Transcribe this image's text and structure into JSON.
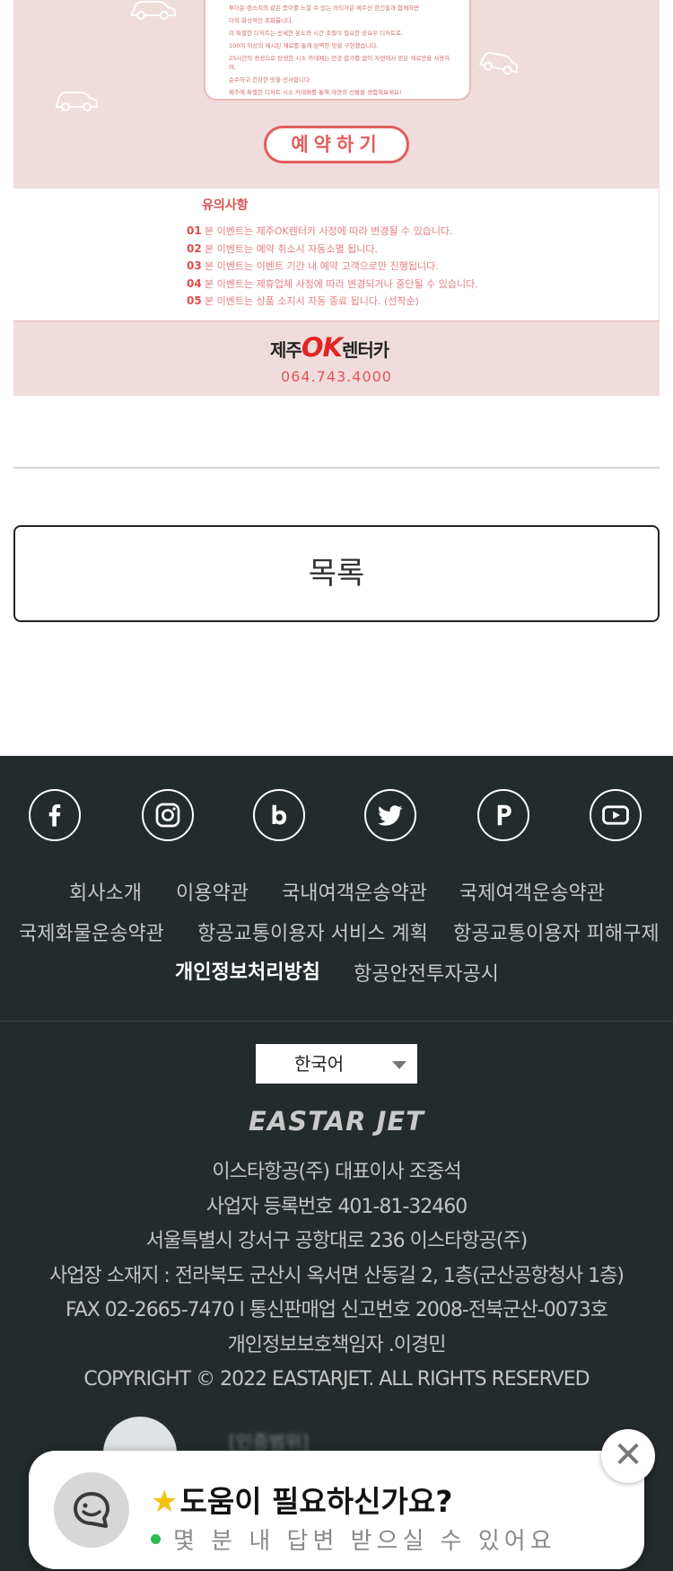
{
  "promo": {
    "card_lines": [
      "투더운 렌스치의 같은 풍이를 느낄 수 있는 카티가은 제주산 한긴들과 함께하면",
      "더욱 화상적인 조화롭니다.",
      "미 특별한 디저트는 선세한 온도와 시간 조절이 필요한 숭요우 디저트로,",
      "100여 이상의 제시된 재료를 통해 완벽한 맛을 구현했습니다.",
      "25시간의 정성으로 탄생한 시소 카데페는 먼공 합가를 없이 자연에서 얻은 재료만을 사용하여,",
      "순수하고 건강한 맛을 선사합니다.",
      "제주에 특별한 디저트 시소 카데페를 통해 자연의 선물을 경험해보세요!"
    ],
    "reserve_label": "예약하기",
    "notice_title": "유의사항",
    "notices": [
      {
        "num": "01",
        "text": "본 이벤트는 제주OK렌터카 사정에 따라 변경될 수 있습니다."
      },
      {
        "num": "02",
        "text": "본 이벤트는 예약 취소시 자동소멸 됩니다."
      },
      {
        "num": "03",
        "text": "본 이벤트는 이벤트 기간 내 예약 고객으로만 진행됩니다."
      },
      {
        "num": "04",
        "text": "본 이벤트는 제휴업체 사정에 따라 변경되거나 중단될 수 있습니다."
      },
      {
        "num": "05",
        "text": "본 이벤트는 상품 소지시 자동 종료 됩니다. (선착순)"
      }
    ],
    "brand_prefix": "제주",
    "brand_ok": "OK",
    "brand_suffix": "렌터카",
    "phone": "064.743.4000"
  },
  "list_button_label": "목록",
  "footer": {
    "social_icons": [
      "facebook-icon",
      "instagram-icon",
      "blog-icon",
      "twitter-icon",
      "post-icon",
      "youtube-icon"
    ],
    "links": [
      "회사소개",
      "이용약관",
      "국내여객운송약관",
      "국제여객운송약관",
      "국제화물운송약관",
      "항공교통이용자 서비스 계획",
      "항공교통이용자 피해구제",
      "개인정보처리방침",
      "항공안전투자공시"
    ],
    "language": "한국어",
    "logo_text": "EASTAR JET",
    "info_lines": [
      "이스타항공(주) 대표이사 조중석",
      "사업자 등록번호 401-81-32460",
      "서울특별시 강서구 공항대로 236 이스타항공(주)",
      "사업장 소재지 : 전라북도 군산시 옥서면 산동길 2, 1층(군산공항청사 1층)",
      "FAX 02-2665-7470 l 통신판매업 신고번호 2008-전북군산-0073호",
      "개인정보보호책임자 .이경민",
      "COPYRIGHT © 2022 EASTARJET. ALL RIGHTS RESERVED"
    ],
    "cert_label": "[인증범위]"
  },
  "chat": {
    "title": "도움이 필요하신가요?",
    "subtitle": "몇 분 내 답변 받으실 수 있어요",
    "close_symbol": "✕"
  },
  "colors": {
    "accent": "#e15d5d",
    "footer_bg": "#242b2c",
    "promo_bg": "#f1dcdc",
    "online_dot": "#2dbb53"
  }
}
